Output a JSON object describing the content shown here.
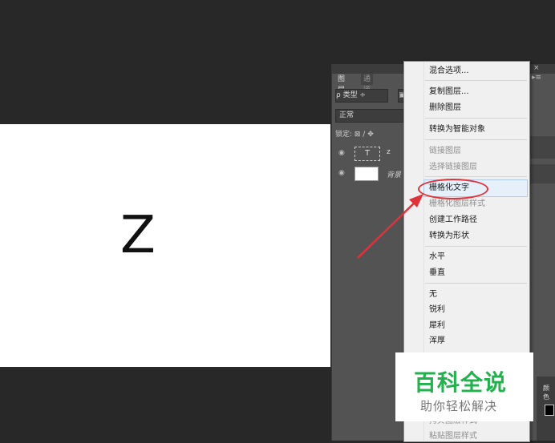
{
  "canvas": {
    "letter": "Z"
  },
  "layers_panel": {
    "tabs": [
      "图层",
      "通道"
    ],
    "filter_label": "ρ 类型 ÷",
    "blend_mode": "正常",
    "lock_label": "锁定: ⊠ ∕ ✥",
    "layers": [
      {
        "thumb": "T",
        "name": "z"
      },
      {
        "name": "背景"
      }
    ],
    "close": "×",
    "menu": "▸≡"
  },
  "context_menu": {
    "items": [
      {
        "label": "混合选项...",
        "enabled": true
      },
      {
        "label": "复制图层...",
        "enabled": true
      },
      {
        "label": "删除图层",
        "enabled": true
      },
      {
        "label": "转换为智能对象",
        "enabled": true
      },
      {
        "label": "链接图层",
        "enabled": false
      },
      {
        "label": "选择链接图层",
        "enabled": false
      },
      {
        "label": "栅格化文字",
        "enabled": true,
        "highlighted": true
      },
      {
        "label": "栅格化图层样式",
        "enabled": false
      },
      {
        "label": "创建工作路径",
        "enabled": true
      },
      {
        "label": "转换为形状",
        "enabled": true
      },
      {
        "label": "水平",
        "enabled": true
      },
      {
        "label": "垂直",
        "enabled": true
      },
      {
        "label": "无",
        "enabled": true
      },
      {
        "label": "锐利",
        "enabled": true
      },
      {
        "label": "犀利",
        "enabled": true
      },
      {
        "label": "浑厚",
        "enabled": true
      },
      {
        "label": "拷贝图层样式",
        "enabled": false
      },
      {
        "label": "粘贴图层样式",
        "enabled": false
      }
    ]
  },
  "right_edge": {
    "label": "颜色"
  },
  "watermark": {
    "title": "百科全说",
    "subtitle": "助你轻松解决"
  },
  "colors": {
    "annotation": "#e0323a",
    "watermark_green": "#22b14c"
  }
}
